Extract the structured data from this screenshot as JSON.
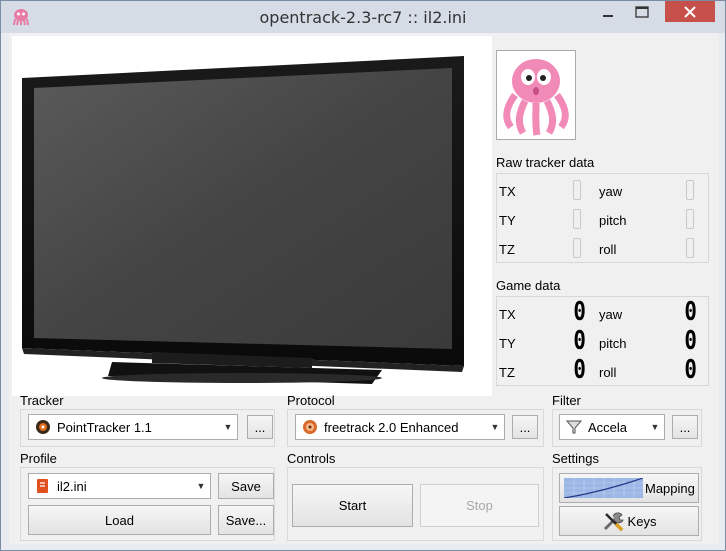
{
  "window": {
    "title": "opentrack-2.3-rc7 :: il2.ini"
  },
  "raw_tracker": {
    "label": "Raw tracker data",
    "rows": [
      {
        "left_label": "TX",
        "right_label": "yaw"
      },
      {
        "left_label": "TY",
        "right_label": "pitch"
      },
      {
        "left_label": "TZ",
        "right_label": "roll"
      }
    ]
  },
  "game_data": {
    "label": "Game data",
    "rows": [
      {
        "left_label": "TX",
        "left_value": "0",
        "right_label": "yaw",
        "right_value": "0"
      },
      {
        "left_label": "TY",
        "left_value": "0",
        "right_label": "pitch",
        "right_value": "0"
      },
      {
        "left_label": "TZ",
        "left_value": "0",
        "right_label": "roll",
        "right_value": "0"
      }
    ]
  },
  "tracker": {
    "label": "Tracker",
    "selected": "PointTracker 1.1",
    "settings_button": "..."
  },
  "protocol": {
    "label": "Protocol",
    "selected": "freetrack 2.0 Enhanced",
    "settings_button": "..."
  },
  "filter": {
    "label": "Filter",
    "selected": "Accela",
    "settings_button": "..."
  },
  "profile": {
    "label": "Profile",
    "selected": "il2.ini",
    "save": "Save",
    "load": "Load",
    "save_as": "Save..."
  },
  "controls": {
    "label": "Controls",
    "start": "Start",
    "stop": "Stop"
  },
  "settings": {
    "label": "Settings",
    "mapping": "Mapping",
    "keys": "Keys"
  }
}
